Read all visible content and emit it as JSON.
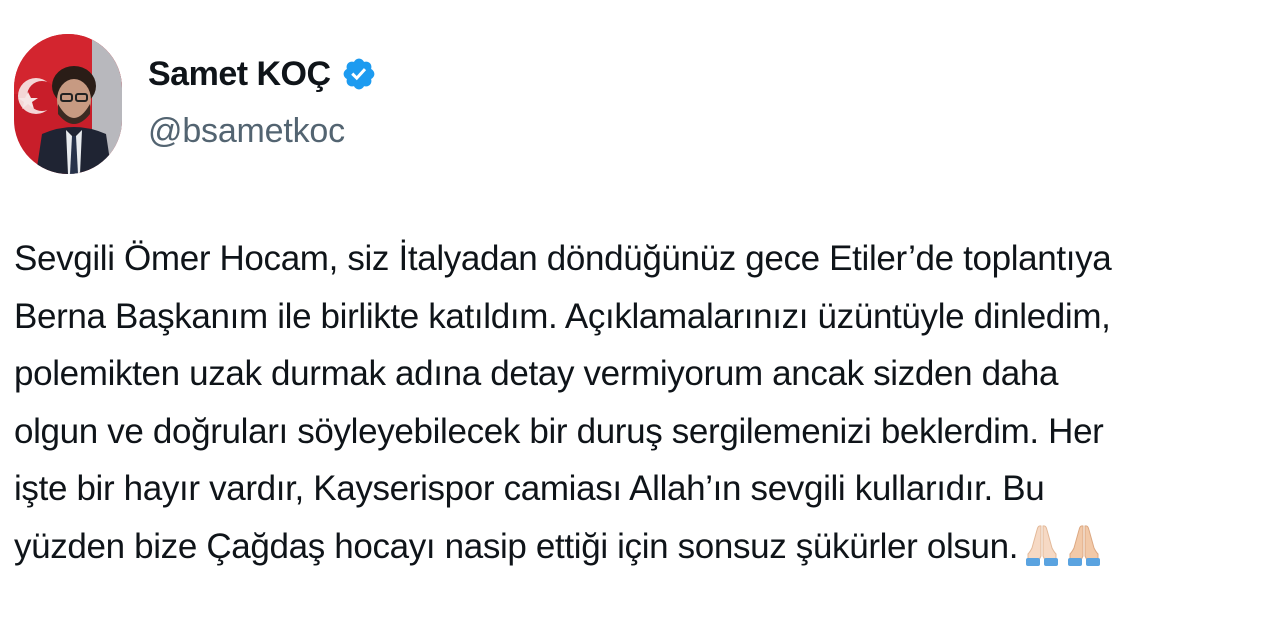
{
  "author": {
    "display_name": "Samet KOÇ",
    "handle": "@bsametkoc",
    "verified": true,
    "verified_icon": "verified-badge-icon",
    "avatar_icon": "profile-avatar"
  },
  "tweet": {
    "lines": [
      "Sevgili Ömer Hocam, siz İtalyadan döndüğünüz gece Etiler’de toplantıya",
      "Berna Başkanım ile birlikte katıldım. Açıklamalarınızı üzüntüyle dinledim,",
      "polemikten uzak durmak adına detay vermiyorum ancak sizden daha",
      "olgun ve doğruları söyleyebilecek bir duruş sergilemenizi beklerdim. Her",
      "işte bir hayır vardır, Kayserispor camiası Allah’ın sevgili kullarıdır. Bu",
      "yüzden bize Çağdaş hocayı nasip ettiği için sonsuz şükürler olsun."
    ],
    "emojis": [
      "folded-hands-icon",
      "folded-hands-icon"
    ]
  },
  "colors": {
    "text_primary": "#0f1419",
    "text_secondary": "#536471",
    "verified_blue": "#1d9bf0"
  }
}
